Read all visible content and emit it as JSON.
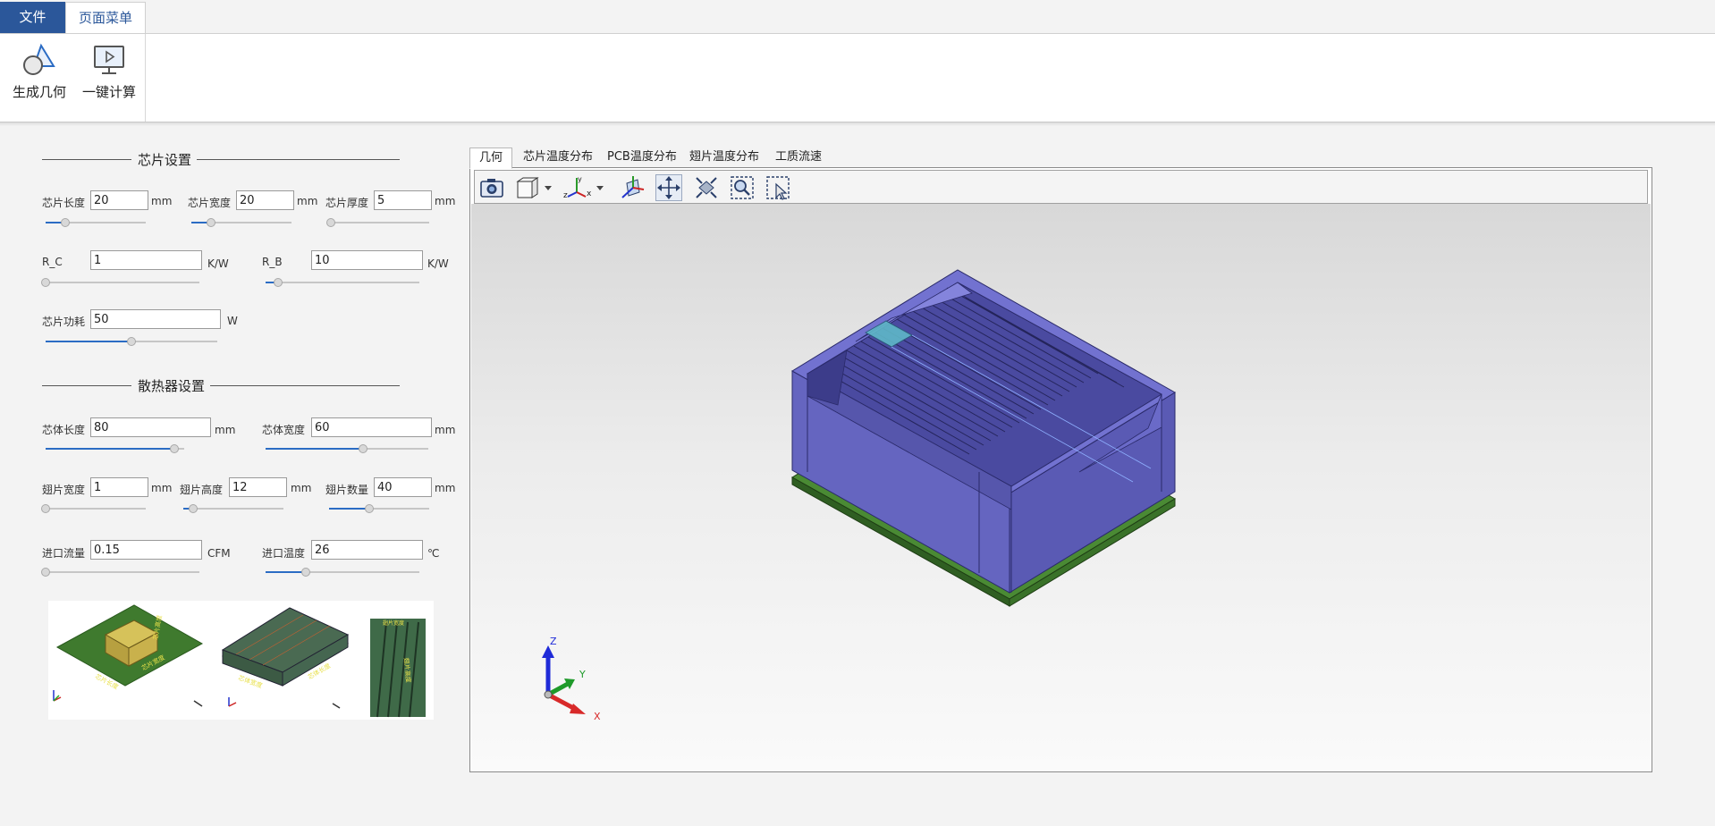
{
  "ribbon": {
    "tabs": [
      {
        "label": "文件"
      },
      {
        "label": "页面菜单"
      }
    ],
    "buttons": [
      {
        "label": "生成几何",
        "icon": "geometry-shapes-icon"
      },
      {
        "label": "一键计算",
        "icon": "monitor-play-icon"
      }
    ]
  },
  "chip_settings": {
    "title": "芯片设置",
    "length": {
      "label": "芯片长度",
      "value": "20",
      "unit": "mm",
      "slider": 0.2
    },
    "width": {
      "label": "芯片宽度",
      "value": "20",
      "unit": "mm",
      "slider": 0.2
    },
    "thickness": {
      "label": "芯片厚度",
      "value": "5",
      "unit": "mm",
      "slider": 0.0
    },
    "r_c": {
      "label": "R_C",
      "value": "1",
      "unit": "K/W",
      "slider": 0.0
    },
    "r_b": {
      "label": "R_B",
      "value": "10",
      "unit": "K/W",
      "slider": 0.08
    },
    "power": {
      "label": "芯片功耗",
      "value": "50",
      "unit": "W",
      "slider": 0.5
    }
  },
  "heatsink_settings": {
    "title": "散热器设置",
    "body_length": {
      "label": "芯体长度",
      "value": "80",
      "unit": "mm",
      "slider": 0.93
    },
    "body_width": {
      "label": "芯体宽度",
      "value": "60",
      "unit": "mm",
      "slider": 0.6
    },
    "fin_width": {
      "label": "翅片宽度",
      "value": "1",
      "unit": "mm",
      "slider": 0.0
    },
    "fin_height": {
      "label": "翅片高度",
      "value": "12",
      "unit": "mm",
      "slider": 0.1
    },
    "fin_count": {
      "label": "翅片数量",
      "value": "40",
      "unit": "mm",
      "slider": 0.4
    },
    "inlet_flow": {
      "label": "进口流量",
      "value": "0.15",
      "unit": "CFM",
      "slider": 0.0
    },
    "inlet_temp": {
      "label": "进口温度",
      "value": "26",
      "unit": "℃",
      "slider": 0.26
    }
  },
  "preview_labels": {
    "chip_length": "芯片长度",
    "chip_width": "芯片宽度",
    "chip_height": "芯片高度",
    "body_length": "芯体长度",
    "body_width": "芯体宽度",
    "fin_width": "翅片宽度",
    "fin_height": "翅片高度"
  },
  "viewer": {
    "tabs": [
      {
        "label": "几何",
        "active": true
      },
      {
        "label": "芯片温度分布"
      },
      {
        "label": "PCB温度分布"
      },
      {
        "label": "翅片温度分布"
      },
      {
        "label": "工质流速"
      }
    ],
    "toolbar": [
      {
        "icon": "camera-icon"
      },
      {
        "icon": "view-cube-icon"
      },
      {
        "icon": "axes-orientation-icon"
      },
      {
        "icon": "rotate-view-icon"
      },
      {
        "icon": "pan-icon"
      },
      {
        "icon": "fit-all-icon"
      },
      {
        "icon": "zoom-box-icon"
      },
      {
        "icon": "select-box-icon"
      }
    ],
    "axes": {
      "x": "X",
      "y": "Y",
      "z": "Z"
    }
  },
  "colors": {
    "ribbon_file_bg": "#2b579a",
    "slider_fill": "#2b6cc4",
    "heatsink": "#6a6ac8",
    "pcb": "#3e7a2c",
    "chip_highlight": "#5fb8c8"
  }
}
